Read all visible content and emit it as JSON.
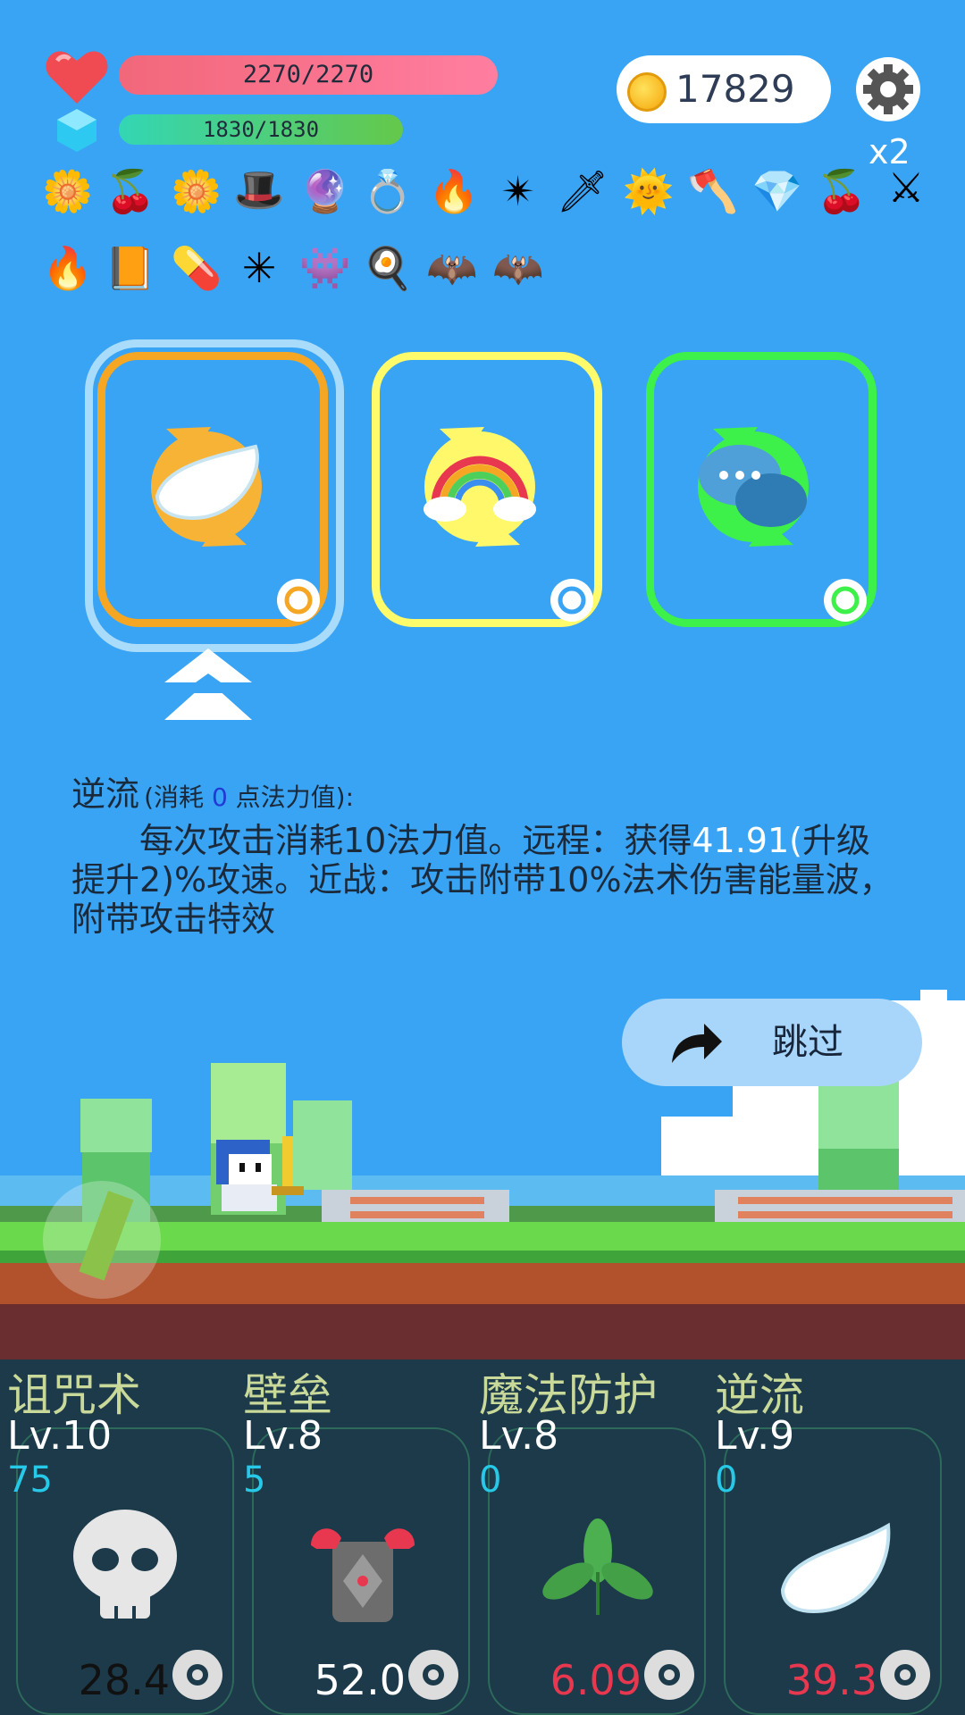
{
  "hud": {
    "hp_text": "2270/2270",
    "mp_text": "1830/1830",
    "coins": "17829",
    "multiplier": "x2"
  },
  "inventory_row1": [
    "flower-icon",
    "cherry-icon",
    "flower-icon",
    "wizard-hat-icon",
    "crystal-ball-icon",
    "ring-icon",
    "torch-icon",
    "spiked-ball-icon",
    "dagger-icon",
    "sun-gem-icon",
    "axe-icon",
    "diamond-icon",
    "cherry-icon",
    "sword-icon"
  ],
  "inventory_row2": [
    "torch-icon",
    "spellbook-icon",
    "pill-icon",
    "mace-icon",
    "goblin-icon",
    "egg-icon",
    "bat-icon",
    "bat-icon"
  ],
  "skill_cards": [
    {
      "name": "wing-card",
      "border": "#f5a623"
    },
    {
      "name": "rainbow-card",
      "border": "#fffb6a"
    },
    {
      "name": "chat-card",
      "border": "#3df04a"
    }
  ],
  "description": {
    "title": "逆流",
    "cost_prefix": "(消耗 ",
    "cost_value": "0",
    "cost_suffix": " 点法力值):",
    "body_part1": "　　每次攻击消耗10法力值。远程：获得",
    "body_highlight": "41.91(",
    "body_part2": "升级提升2)%攻速。近战：攻击附带10%法术伤害能量波，附带攻击特效"
  },
  "skip_button": {
    "label": "跳过"
  },
  "bottom_skills": [
    {
      "name": "诅咒术",
      "level": "Lv.10",
      "count": "75",
      "value": "28.4",
      "value_color": "#111111",
      "icon": "skull-icon"
    },
    {
      "name": "壁垒",
      "level": "Lv.8",
      "count": "5",
      "value": "52.0",
      "value_color": "#ffffff",
      "icon": "armor-icon"
    },
    {
      "name": "魔法防护",
      "level": "Lv.8",
      "count": "0",
      "value": "6.09",
      "value_color": "#e8384f",
      "icon": "leaf-icon"
    },
    {
      "name": "逆流",
      "level": "Lv.9",
      "count": "0",
      "value": "39.3",
      "value_color": "#e8384f",
      "icon": "wing-icon"
    }
  ]
}
